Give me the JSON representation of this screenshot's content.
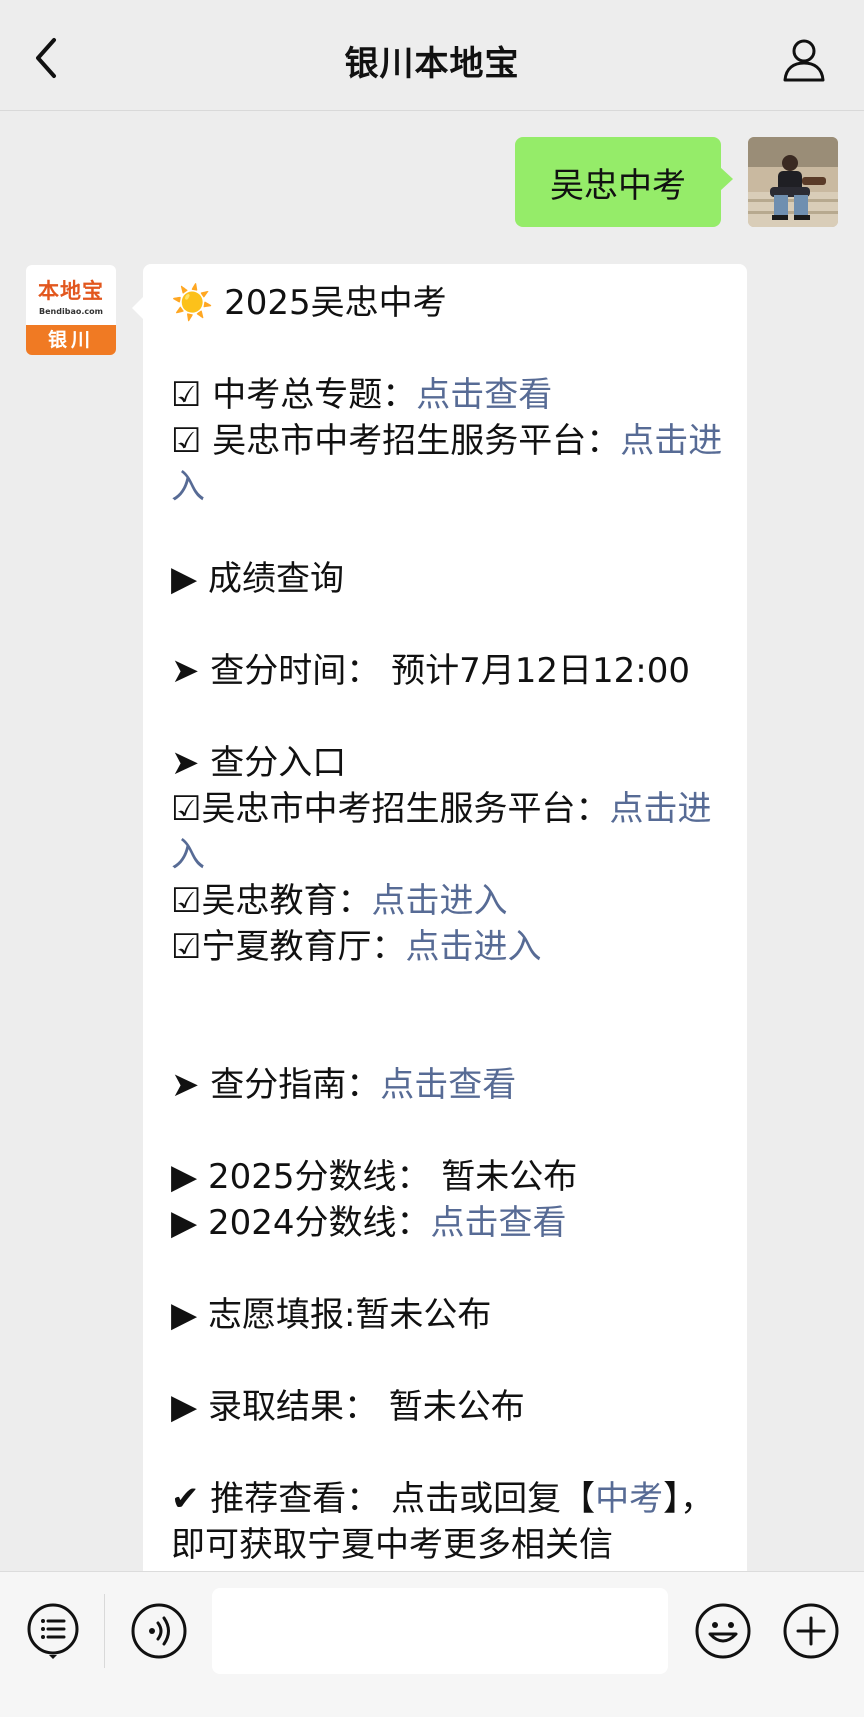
{
  "header": {
    "title": "银川本地宝",
    "back_icon": "chevron-left-icon",
    "profile_icon": "person-icon"
  },
  "self_message": {
    "text": "吴忠中考"
  },
  "bot": {
    "avatar": {
      "logo_text": "本地宝",
      "logo_domain": "Bendibao.com",
      "city": "银川"
    },
    "lines": [
      {
        "prefix": "2025吴忠中考",
        "icon": "sun"
      },
      {
        "gap": true
      },
      {
        "prefix": "☑ 中考总专题：",
        "link": "点击查看"
      },
      {
        "prefix": "☑ 吴忠市中考招生服务平台：",
        "link": "点击进入"
      },
      {
        "gap": true
      },
      {
        "prefix": "▶ 成绩查询"
      },
      {
        "gap": true
      },
      {
        "prefix": "➤ 查分时间： 预计7月12日12:00"
      },
      {
        "gap": true
      },
      {
        "prefix": "➤ 查分入口"
      },
      {
        "prefix": "☑吴忠市中考招生服务平台：",
        "link": "点击进入"
      },
      {
        "prefix": "☑吴忠教育：",
        "link": "点击进入"
      },
      {
        "prefix": "☑宁夏教育厅：",
        "link": "点击进入"
      },
      {
        "gap": true
      },
      {
        "gap": true
      },
      {
        "prefix": "➤ 查分指南：",
        "link": "点击查看"
      },
      {
        "gap": true
      },
      {
        "prefix": "▶ 2025分数线： 暂未公布"
      },
      {
        "prefix": "▶ 2024分数线：",
        "link": "点击查看"
      },
      {
        "gap": true
      },
      {
        "prefix": "▶ 志愿填报:暂未公布"
      },
      {
        "gap": true
      },
      {
        "prefix": "▶ 录取结果： 暂未公布"
      },
      {
        "gap": true
      },
      {
        "prefix": "✔ 推荐查看： 点击或回复【",
        "link": "中考",
        "suffix": "】，即可获取宁夏中考更多相关信"
      }
    ]
  },
  "inputbar": {
    "voice_icon": "voice-icon",
    "menu_icon": "menu-list-icon",
    "emoji_icon": "emoji-icon",
    "plus_icon": "plus-icon",
    "input_value": ""
  }
}
